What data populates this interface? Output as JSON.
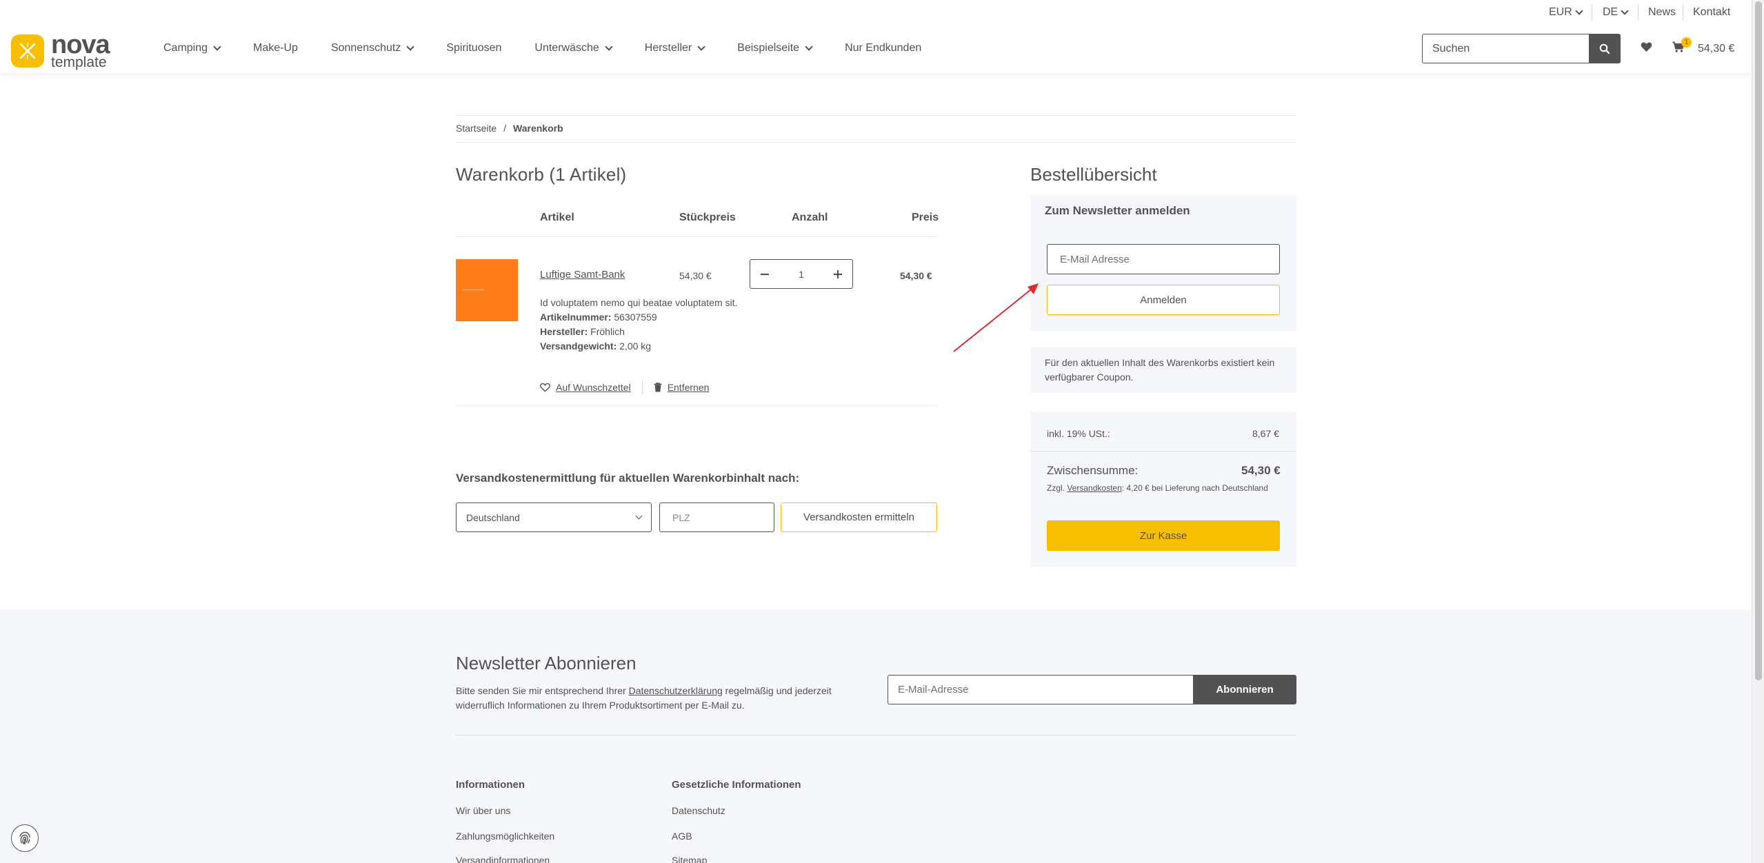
{
  "topbar": {
    "currency": "EUR",
    "language": "DE",
    "news": "News",
    "contact": "Kontakt"
  },
  "header": {
    "logo_line1": "nova",
    "logo_line2": "template",
    "nav": [
      "Camping",
      "Make-Up",
      "Sonnenschutz",
      "Spirituosen",
      "Unterwäsche",
      "Hersteller",
      "Beispielseite",
      "Nur Endkunden"
    ],
    "search_placeholder": "Suchen",
    "cart_count": "1",
    "cart_total": "54,30 €"
  },
  "breadcrumb": {
    "home": "Startseite",
    "separator": "/",
    "current": "Warenkorb"
  },
  "cart": {
    "title": "Warenkorb (1 Artikel)",
    "headers": {
      "article": "Artikel",
      "unit_price": "Stückpreis",
      "quantity": "Anzahl",
      "price": "Preis"
    },
    "item": {
      "name": "Luftige Samt-Bank",
      "unit_price": "54,30 €",
      "quantity": "1",
      "price": "54,30 €",
      "description": "Id voluptatem nemo qui beatae voluptatem sit.",
      "sku_label": "Artikelnummer:",
      "sku": "56307559",
      "manufacturer_label": "Hersteller:",
      "manufacturer": "Fröhlich",
      "weight_label": "Versandgewicht:",
      "weight": "2,00 kg",
      "wishlist": "Auf Wunschzettel",
      "remove": "Entfernen"
    }
  },
  "shipping": {
    "title": "Versandkostenermittlung für aktuellen Warenkorbinhalt nach:",
    "country": "Deutschland",
    "zip_placeholder": "PLZ",
    "button": "Versandkosten ermitteln"
  },
  "summary": {
    "title": "Bestellübersicht",
    "newsletter_title": "Zum Newsletter anmelden",
    "email_placeholder": "E-Mail Adresse",
    "subscribe_button": "Anmelden",
    "coupon_text": "Für den aktuellen Inhalt des Warenkorbs existiert kein verfügbarer Coupon.",
    "tax_label": "inkl. 19% USt.:",
    "tax_value": "8,67 €",
    "subtotal_label": "Zwischensumme:",
    "subtotal_value": "54,30 €",
    "ship_note_pre": "Zzgl.",
    "ship_note_link": "Versandkosten",
    "ship_note_post": ": 4,20 € bei Lieferung nach Deutschland",
    "checkout_button": "Zur Kasse"
  },
  "footer": {
    "newsletter_title": "Newsletter Abonnieren",
    "text_pre": "Bitte senden Sie mir entsprechend Ihrer",
    "text_link": "Datenschutzerklärung",
    "text_post": "regelmäßig und jederzeit widerruflich Informationen zu Ihrem Produktsortiment per E-Mail zu.",
    "email_placeholder": "E-Mail-Adresse",
    "subscribe_button": "Abonnieren",
    "col1_title": "Informationen",
    "col1_links": [
      "Wir über uns",
      "Zahlungsmöglichkeiten",
      "Versandinformationen"
    ],
    "col2_title": "Gesetzliche Informationen",
    "col2_links": [
      "Datenschutz",
      "AGB",
      "Sitemap"
    ]
  },
  "colors": {
    "accent": "#f8bf00",
    "text": "#525252",
    "product_image": "#ff7d1a",
    "panel_bg": "#f5f7fa",
    "annotation_arrow": "#e0282e"
  },
  "icons": [
    "logo-icon",
    "search-icon",
    "user-icon",
    "heart-icon",
    "cart-icon",
    "minus-icon",
    "plus-icon",
    "trash-icon",
    "chevron-down-icon",
    "fingerprint-icon"
  ]
}
